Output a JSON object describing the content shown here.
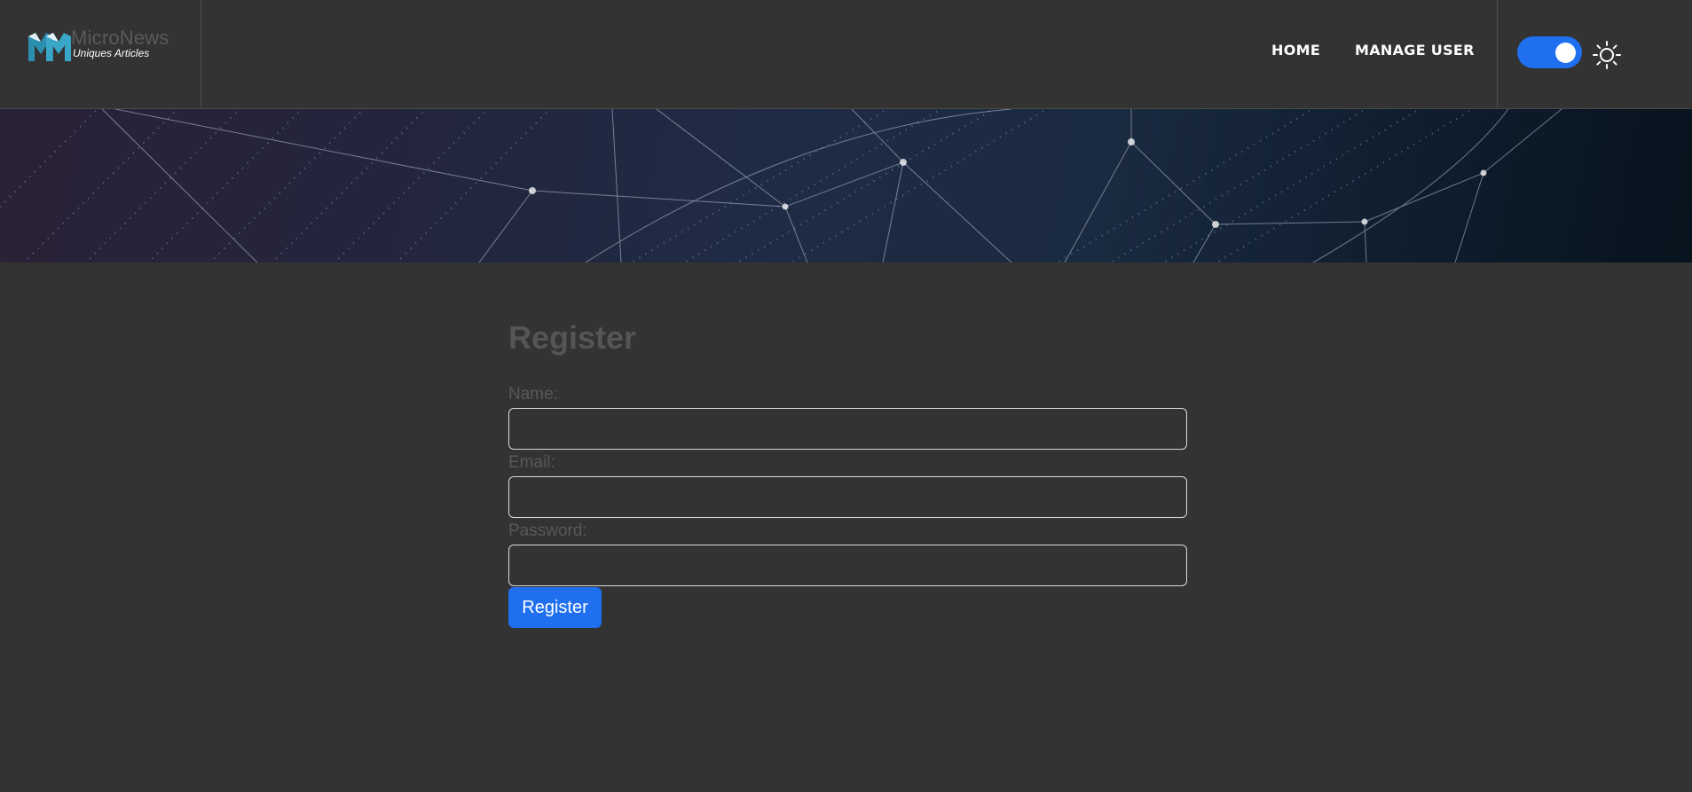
{
  "brand": {
    "name": "MicroNews",
    "tagline": "Uniques Articles",
    "logo_text": "MN"
  },
  "nav": {
    "items": [
      {
        "label": "HOME"
      },
      {
        "label": "MANAGE USER"
      }
    ]
  },
  "theme": {
    "toggle_on": true,
    "accent": "#1f6fef",
    "icon": "sun-icon"
  },
  "form": {
    "title": "Register",
    "fields": [
      {
        "label": "Name:",
        "value": ""
      },
      {
        "label": "Email:",
        "value": ""
      },
      {
        "label": "Password:",
        "value": ""
      }
    ],
    "submit_label": "Register"
  }
}
